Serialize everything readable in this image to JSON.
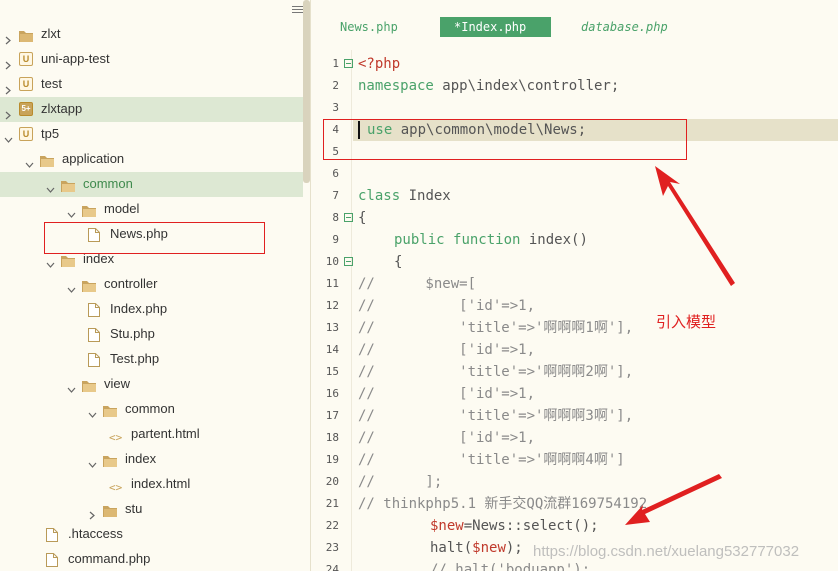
{
  "sidebar": {
    "items": [
      {
        "label": "zlxt",
        "type": "folder-closed-badge"
      },
      {
        "label": "uni-app-test",
        "type": "project"
      },
      {
        "label": "test",
        "type": "project"
      },
      {
        "label": "zlxtapp",
        "type": "project-active"
      },
      {
        "label": "tp5",
        "type": "project-open"
      },
      {
        "label": "application",
        "type": "folder-open"
      },
      {
        "label": "common",
        "type": "folder-open"
      },
      {
        "label": "model",
        "type": "folder-open"
      },
      {
        "label": "News.php",
        "type": "file"
      },
      {
        "label": "index",
        "type": "folder-open"
      },
      {
        "label": "controller",
        "type": "folder-open"
      },
      {
        "label": "Index.php",
        "type": "file"
      },
      {
        "label": "Stu.php",
        "type": "file"
      },
      {
        "label": "Test.php",
        "type": "file"
      },
      {
        "label": "view",
        "type": "folder-open"
      },
      {
        "label": "common",
        "type": "folder-open"
      },
      {
        "label": "partent.html",
        "type": "html"
      },
      {
        "label": "index",
        "type": "folder-open"
      },
      {
        "label": "index.html",
        "type": "html"
      },
      {
        "label": "stu",
        "type": "folder-closed"
      },
      {
        "label": ".htaccess",
        "type": "file"
      },
      {
        "label": "command.php",
        "type": "file"
      }
    ]
  },
  "tabs": [
    {
      "label": "News.php",
      "state": "inactive"
    },
    {
      "label": "*Index.php",
      "state": "active"
    },
    {
      "label": "database.php",
      "state": "inactive"
    }
  ],
  "editor": {
    "line_numbers": [
      "1",
      "2",
      "3",
      "4",
      "5",
      "6",
      "7",
      "8",
      "9",
      "10",
      "11",
      "12",
      "13",
      "14",
      "15",
      "16",
      "17",
      "18",
      "19",
      "20",
      "21",
      "22",
      "23",
      "24"
    ],
    "lines": {
      "l1": "<?php",
      "l2": "namespace app\\index\\controller;",
      "l4_kw": "use",
      "l4_rest": " app\\common\\model\\News;",
      "l7_kw": "class",
      "l7_rest": " Index",
      "l8": "{",
      "l9_kw1": "public",
      "l9_kw2": "function",
      "l9_rest": " index()",
      "l10": "{",
      "l11": "//      $new=[",
      "l12": "//          ['id'=>1,",
      "l13": "//          'title'=>'啊啊啊1啊'],",
      "l14": "//          ['id'=>1,",
      "l15": "//          'title'=>'啊啊啊2啊'],",
      "l16": "//          ['id'=>1,",
      "l17": "//          'title'=>'啊啊啊3啊'],",
      "l18": "//          ['id'=>1,",
      "l19": "//          'title'=>'啊啊啊4啊']",
      "l20": "//      ];",
      "l21": "// thinkphp5.1 新手交QQ流群169754192",
      "l22_var": "$new",
      "l22_rest": "=News::select();",
      "l23_pre": "halt(",
      "l23_var": "$new",
      "l23_post": ");",
      "l24": "// halt('boduapp');"
    }
  },
  "annotation": {
    "note": "引入模型",
    "color": "#e02020"
  },
  "watermark": "https://blog.csdn.net/xuelang532777032",
  "colors": {
    "accent": "#4aa26a",
    "background": "#fdfbf2",
    "highlight_line": "#e6e1c9",
    "tree_selection": "#dde8d3"
  }
}
